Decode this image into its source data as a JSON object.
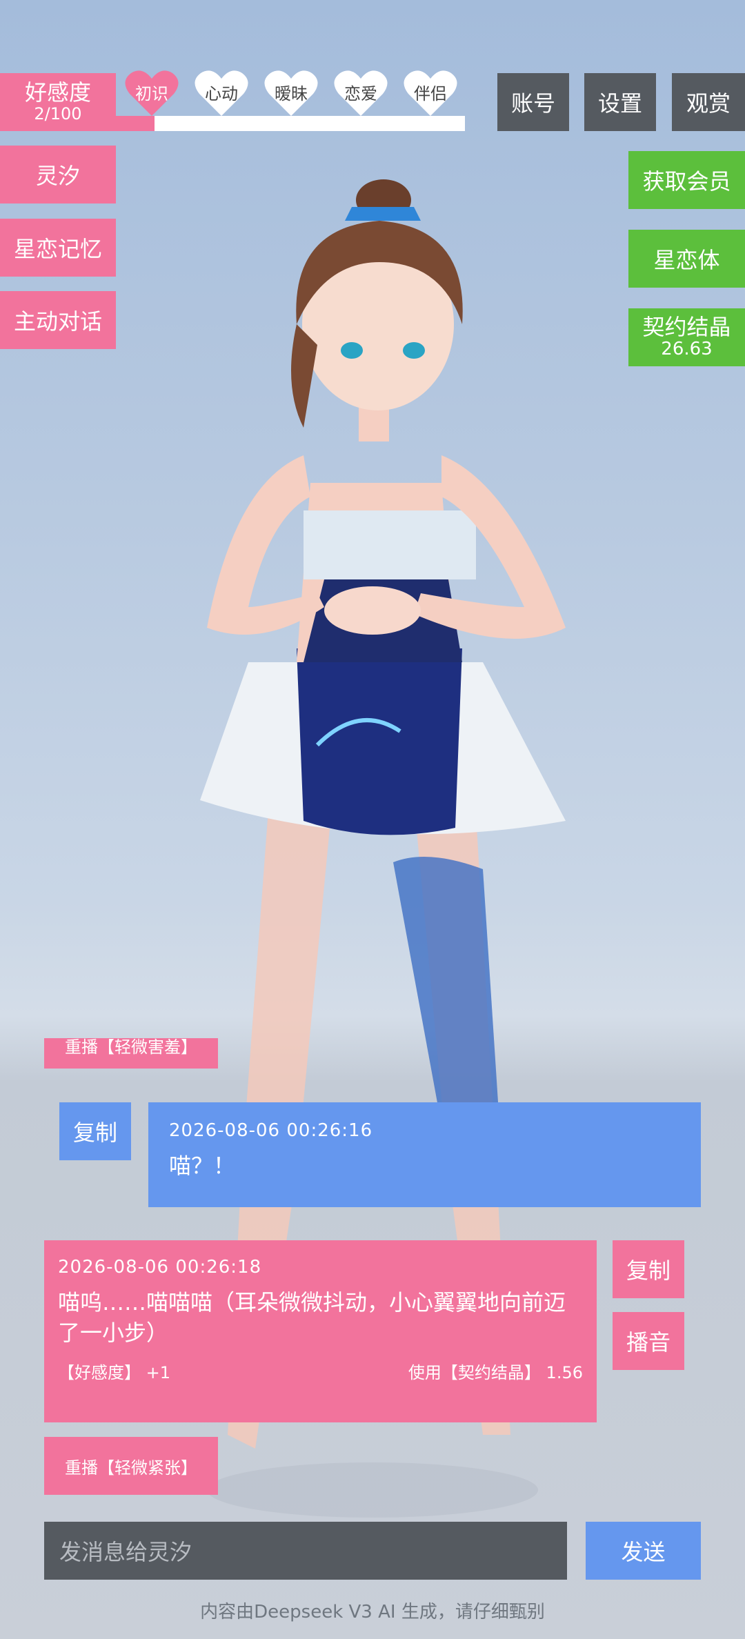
{
  "affection": {
    "title": "好感度",
    "value": "2/100",
    "progress_fraction": 0.02,
    "stages": [
      "初识",
      "心动",
      "暧昧",
      "恋爱",
      "伴侣"
    ],
    "active_stage": "初识"
  },
  "top_menu": {
    "account": "账号",
    "settings": "设置",
    "view": "观赏"
  },
  "left_menu": {
    "character": "灵汐",
    "memory": "星恋记忆",
    "talk": "主动对话"
  },
  "right_menu": {
    "membership": "获取会员",
    "body": "星恋体",
    "crystal_label": "契约结晶",
    "crystal_value": "26.63"
  },
  "chat": {
    "partial_replay": "重播【轻微害羞】",
    "user_message": {
      "time": "2026-08-06 00:26:16",
      "text": "喵？！",
      "copy": "复制"
    },
    "ai_message": {
      "time": "2026-08-06 00:26:18",
      "text": "喵呜……喵喵喵（耳朵微微抖动，小心翼翼地向前迈了一小步）",
      "affection_change": "【好感度】 +1",
      "cost": "使用【契约结晶】 1.56",
      "copy": "复制",
      "play": "播音",
      "replay": "重播【轻微紧张】"
    }
  },
  "input": {
    "placeholder": "发消息给灵汐",
    "send": "发送"
  },
  "footer": "内容由Deepseek V3 AI 生成，请仔细甄别",
  "colors": {
    "pink": "#f2739c",
    "gray": "#555a60",
    "green": "#5cbf3c",
    "blue": "#6597ee"
  }
}
